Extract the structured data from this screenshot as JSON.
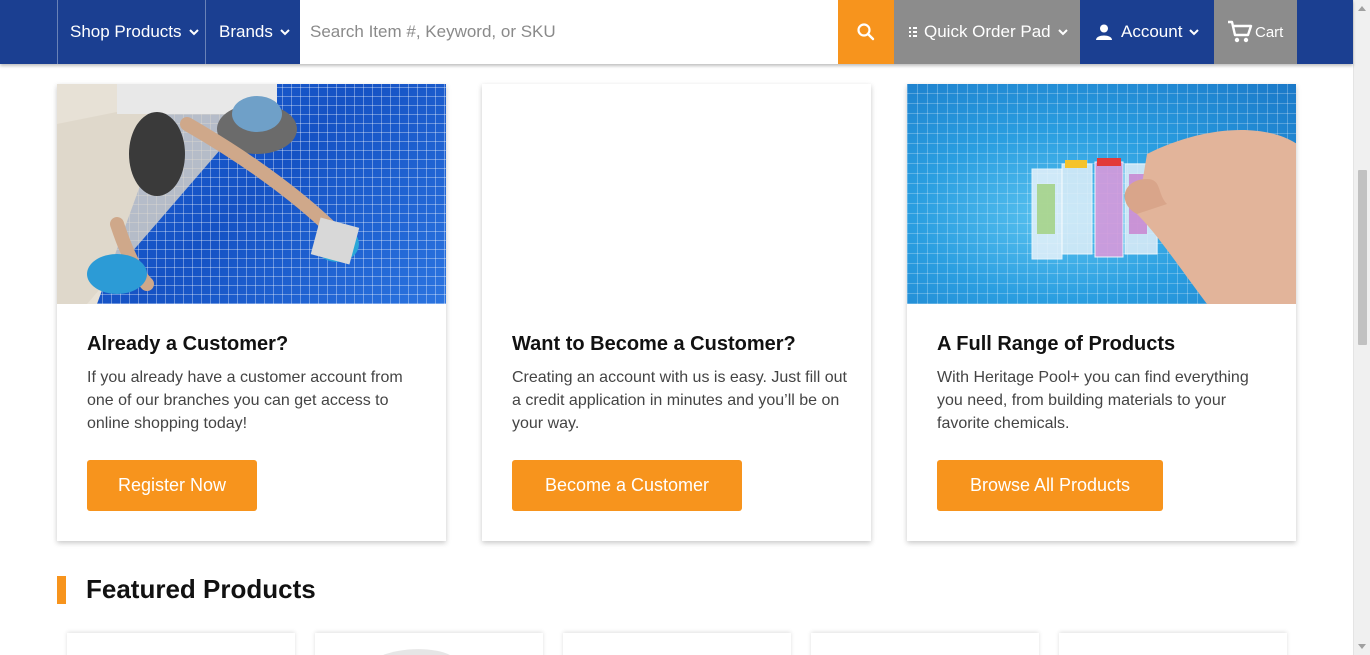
{
  "nav": {
    "shop_label": "Shop Products",
    "brands_label": "Brands",
    "search_placeholder": "Search Item #, Keyword, or SKU",
    "quick_order_label": "Quick Order Pad",
    "account_label": "Account",
    "cart_label": "Cart"
  },
  "cards": [
    {
      "title": "Already a Customer?",
      "text": "If you already have a customer account from one of our branches you can get access to online shopping today!",
      "button": "Register Now"
    },
    {
      "title": "Want to Become a Customer?",
      "text": "Creating an account with us is easy. Just fill out a credit application in minutes and you’ll be on your way.",
      "button": "Become a Customer"
    },
    {
      "title": "A Full Range of Products",
      "text": "With Heritage Pool+ you can find everything you need, from building materials to your favorite chemicals.",
      "button": "Browse All Products"
    }
  ],
  "featured": {
    "title": "Featured Products"
  },
  "colors": {
    "nav_blue": "#1b3f91",
    "accent_orange": "#f7941d",
    "nav_gray": "#8c8c8c"
  }
}
